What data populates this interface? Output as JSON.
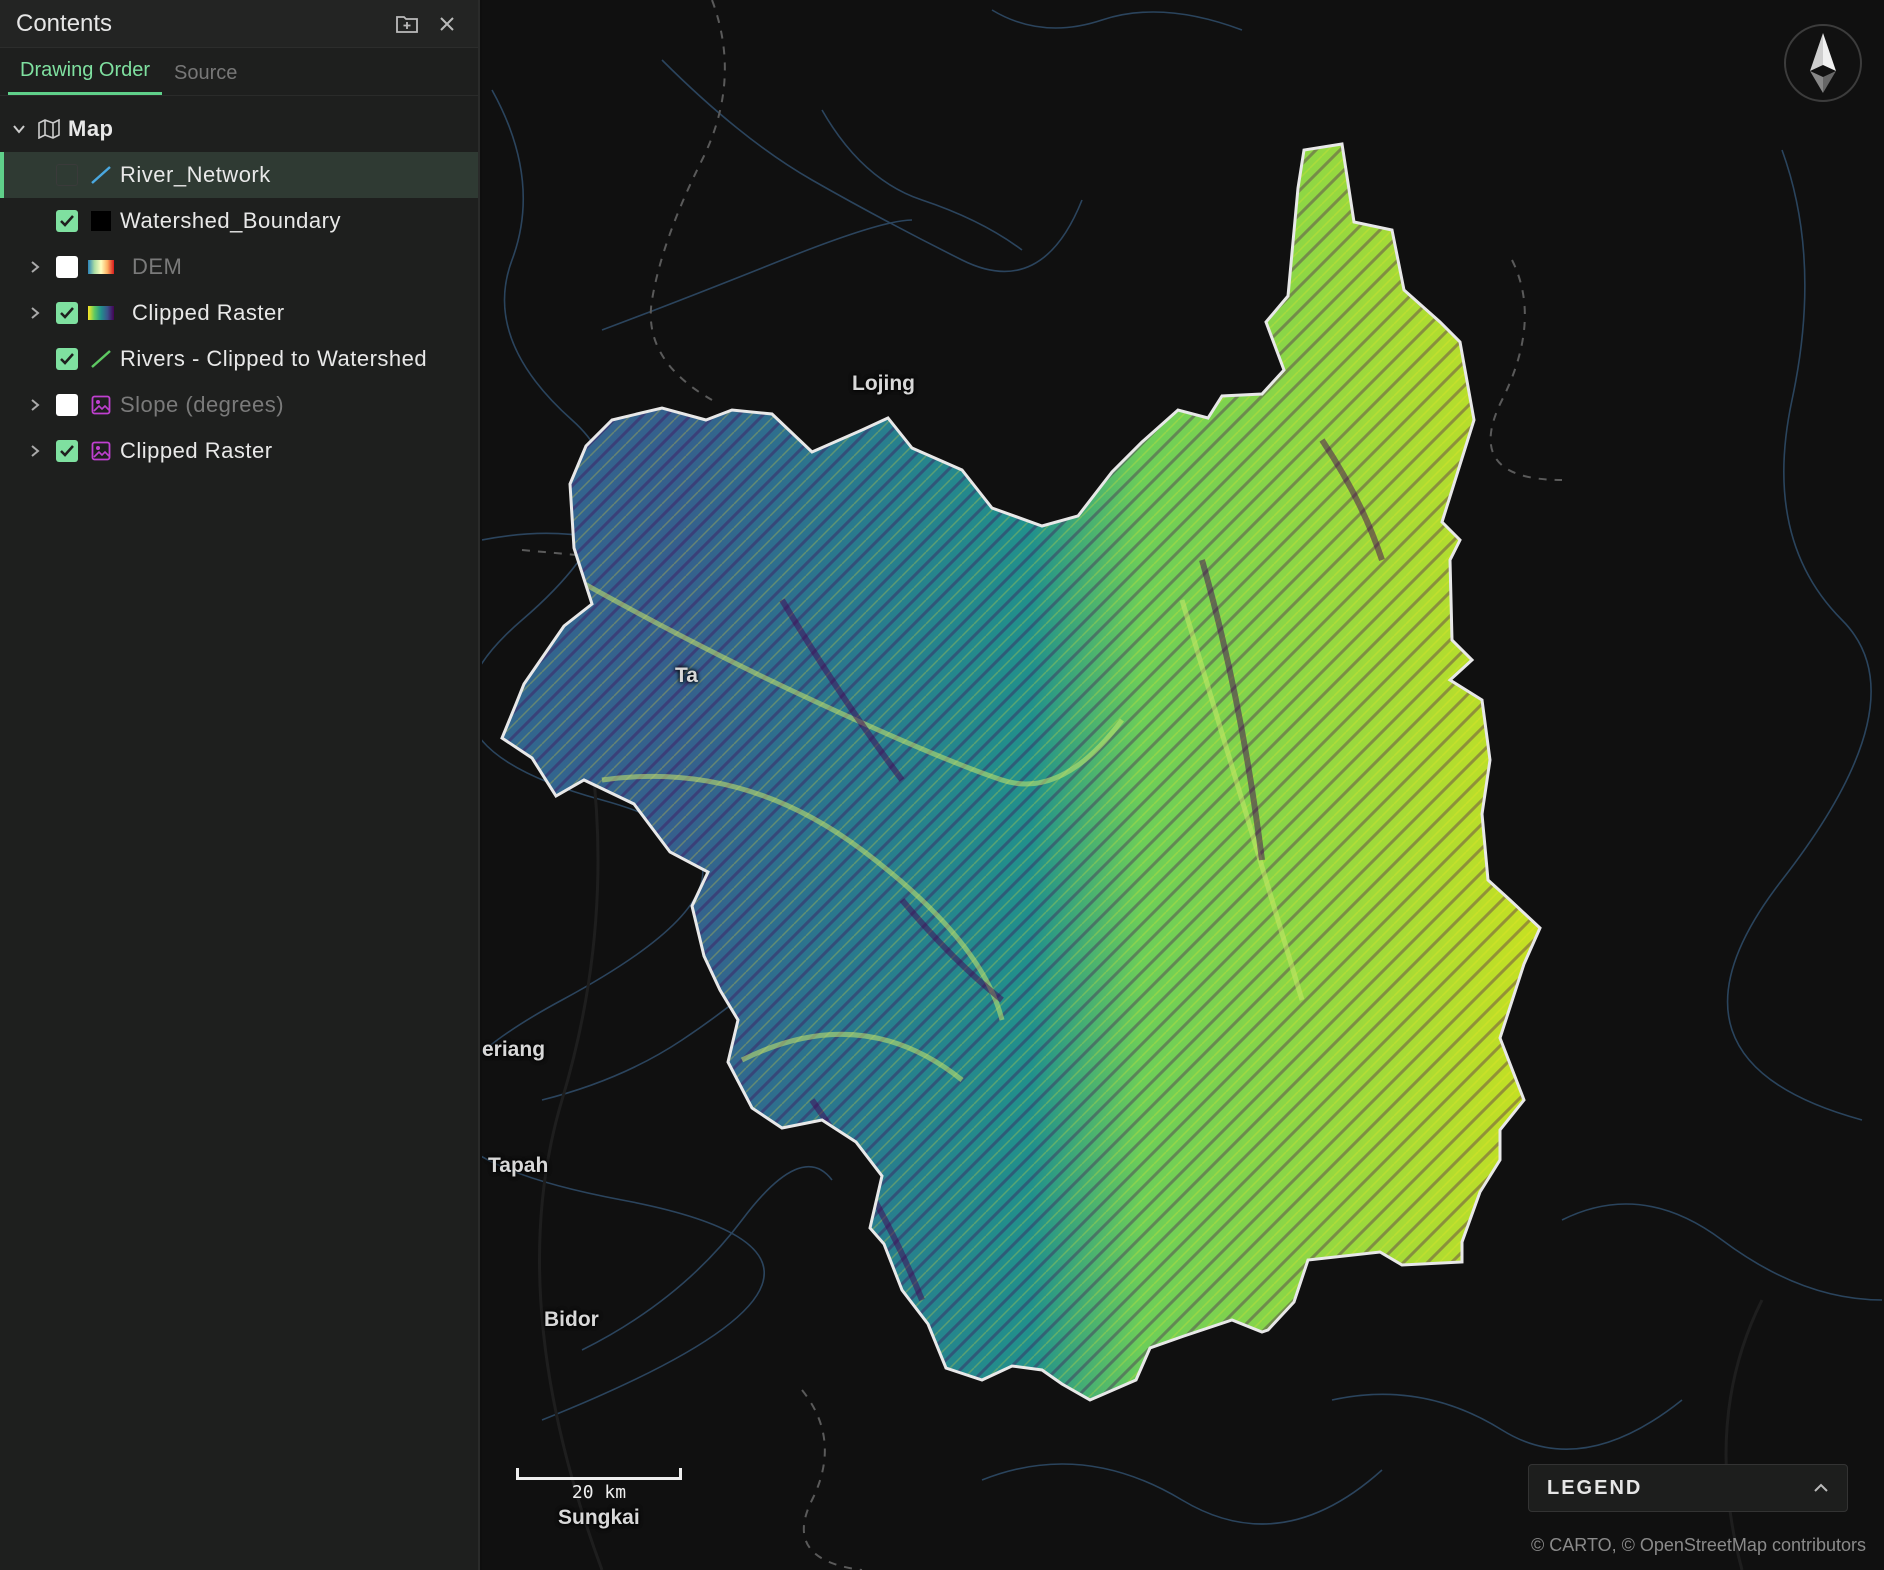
{
  "panel": {
    "title": "Contents",
    "tabs": [
      {
        "label": "Drawing Order",
        "active": true
      },
      {
        "label": "Source",
        "active": false
      }
    ]
  },
  "tree": {
    "root_label": "Map",
    "layers": [
      {
        "label": "River_Network",
        "checked": null,
        "symbol": "line-blue",
        "expandable": false,
        "selected": true,
        "dim": false
      },
      {
        "label": "Watershed_Boundary",
        "checked": true,
        "symbol": "fill-black",
        "expandable": false,
        "selected": false,
        "dim": false
      },
      {
        "label": "DEM",
        "checked": false,
        "symbol": "ramp-spectral",
        "expandable": true,
        "selected": false,
        "dim": true
      },
      {
        "label": "Clipped Raster",
        "checked": true,
        "symbol": "ramp-viridis",
        "expandable": true,
        "selected": false,
        "dim": false
      },
      {
        "label": "Rivers - Clipped to Watershed",
        "checked": true,
        "symbol": "line-green",
        "expandable": false,
        "selected": false,
        "dim": false
      },
      {
        "label": "Slope (degrees)",
        "checked": false,
        "symbol": "image-icon",
        "expandable": true,
        "selected": false,
        "dim": true
      },
      {
        "label": "Clipped Raster",
        "checked": true,
        "symbol": "image-icon",
        "expandable": true,
        "selected": false,
        "dim": false
      }
    ]
  },
  "map": {
    "places": [
      "Lojing",
      "Ta",
      "eriang",
      "Tapah",
      "Bidor",
      "Sungkai"
    ],
    "scale_label": "20 km",
    "legend_label": "LEGEND",
    "attribution": "© CARTO, © OpenStreetMap contributors"
  },
  "colors": {
    "accent": "#5fd08a",
    "checkbox_on": "#7fe0a0",
    "map_background": "#101010",
    "river": "#2e4a66",
    "viridis": [
      "#440154",
      "#3b528b",
      "#21918c",
      "#5ec962",
      "#fde725"
    ]
  }
}
